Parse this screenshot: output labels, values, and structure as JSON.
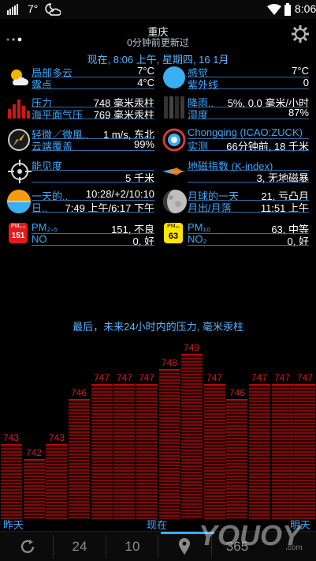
{
  "status": {
    "temperature": "7°",
    "time": "8:06"
  },
  "header": {
    "city": "重庆",
    "updated": "0分钟前更新过",
    "now": "现在, 8:06 上午, 星期四, 16 1月"
  },
  "rows": [
    {
      "label1": "局部多云",
      "value1": "7°C",
      "label2": "露点",
      "value2": "4°C",
      "label3": "感觉",
      "value3": "7°C",
      "label4": "紫外线",
      "value4": "0"
    },
    {
      "label1": "压力",
      "value1": "748 毫米汞柱",
      "label2": "海平面气压",
      "value2": "769 毫米汞柱",
      "label3": "降雨..",
      "value3": "5%, 0.0 毫米/小时",
      "label4": "湿度",
      "value4": "87%"
    },
    {
      "label1": "轻微／微風..",
      "value1": "1 m/s, 东北",
      "label2": "云端覆盖",
      "value2": "99%",
      "label3": "Chongqing (ICAO:ZUCK)",
      "value3": "",
      "label4": "实测",
      "value4": "66分钟前, 18 千米"
    },
    {
      "label1": "能见度",
      "value1": "",
      "label2": "",
      "value2": "5 千米",
      "label3": "地磁指数 (K-index)",
      "value3": "",
      "label4": "",
      "value4": "3, 无地磁暴"
    },
    {
      "label1": "一天的..",
      "value1": "10:28/+2/10:10",
      "label2": "日..",
      "value2": "7:49 上午/6:17 下午",
      "label3": "月球的一天",
      "value3": "21, 亏凸月",
      "label4": "月出/月落",
      "value4": "11:51 上午"
    },
    {
      "label1": "PM₂.₅",
      "value1": "151, 不良",
      "label2": "NO",
      "value2": "0, 好",
      "label3": "PM₁₀",
      "value3": "63, 中等",
      "label4": "NO₂",
      "value4": "0, 好"
    }
  ],
  "badges": {
    "pm25_title": "PM₂.₅",
    "pm25_value": "151",
    "pm10_title": "PM₁₀",
    "pm10_value": "63"
  },
  "chart_data": {
    "type": "bar",
    "title": "最后，未来24小时内的压力, 毫米汞柱",
    "values": [
      743,
      742,
      743,
      746,
      747,
      747,
      747,
      748,
      749,
      747,
      746,
      747,
      747,
      747
    ],
    "x_labels": [
      "昨天",
      "现在",
      "明天"
    ],
    "ylim": [
      738,
      750
    ],
    "colors": {
      "bar": "#7a0b0b",
      "label": "#d01c1c"
    }
  },
  "bottom": {
    "hours": "24",
    "days": "10",
    "year": "365"
  },
  "watermark": "YOUOY.com"
}
